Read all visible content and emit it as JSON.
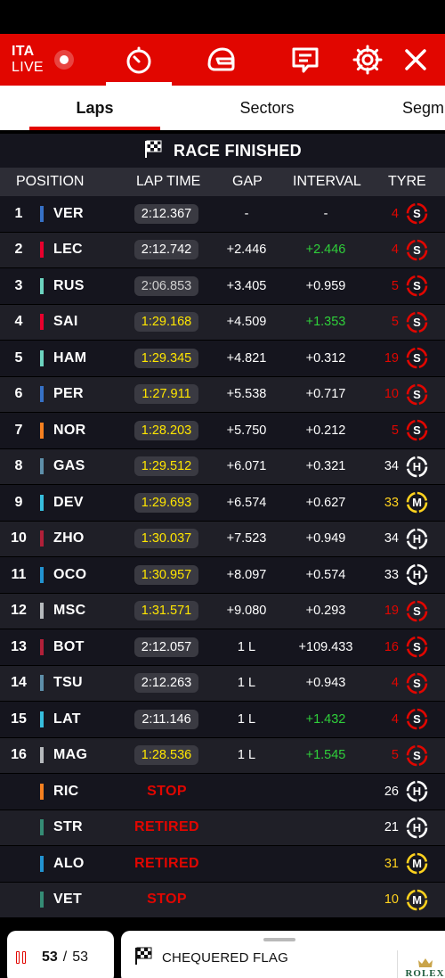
{
  "topbar": {
    "session_code": "ITA",
    "live_label": "LIVE",
    "icons": [
      "timer-icon",
      "helmet-icon",
      "chat-icon",
      "gear-icon",
      "close-icon"
    ],
    "accent": "#e10600"
  },
  "tabs": [
    {
      "label": "Laps",
      "active": true
    },
    {
      "label": "Sectors",
      "active": false
    },
    {
      "label": "Segm",
      "active": false
    }
  ],
  "race_status": {
    "label": "RACE FINISHED",
    "icon": "chequered-flag-icon"
  },
  "columns": {
    "position": "POSITION",
    "lap_time": "LAP TIME",
    "gap": "GAP",
    "interval": "INTERVAL",
    "tyre": "TYRE"
  },
  "colors": {
    "fastest_lap": "#ffe600",
    "interval_gain": "#2fcf3a",
    "soft": "#e10600",
    "medium": "#ffd21e",
    "hard": "#ffffff"
  },
  "drivers": [
    {
      "pos": "1",
      "code": "VER",
      "team_color": "#3671c6",
      "lap_time": "2:12.367",
      "lap_style": "normal",
      "gap": "-",
      "interval": "-",
      "interval_green": false,
      "laps": "4",
      "tyre": "S"
    },
    {
      "pos": "2",
      "code": "LEC",
      "team_color": "#e8002d",
      "lap_time": "2:12.742",
      "lap_style": "normal",
      "gap": "+2.446",
      "interval": "+2.446",
      "interval_green": true,
      "laps": "4",
      "tyre": "S"
    },
    {
      "pos": "3",
      "code": "RUS",
      "team_color": "#6cd3bf",
      "lap_time": "2:06.853",
      "lap_style": "dim",
      "gap": "+3.405",
      "interval": "+0.959",
      "interval_green": false,
      "laps": "5",
      "tyre": "S"
    },
    {
      "pos": "4",
      "code": "SAI",
      "team_color": "#e8002d",
      "lap_time": "1:29.168",
      "lap_style": "fast",
      "gap": "+4.509",
      "interval": "+1.353",
      "interval_green": true,
      "laps": "5",
      "tyre": "S"
    },
    {
      "pos": "5",
      "code": "HAM",
      "team_color": "#6cd3bf",
      "lap_time": "1:29.345",
      "lap_style": "fast",
      "gap": "+4.821",
      "interval": "+0.312",
      "interval_green": false,
      "laps": "19",
      "tyre": "S"
    },
    {
      "pos": "6",
      "code": "PER",
      "team_color": "#3671c6",
      "lap_time": "1:27.911",
      "lap_style": "fast",
      "gap": "+5.538",
      "interval": "+0.717",
      "interval_green": false,
      "laps": "10",
      "tyre": "S"
    },
    {
      "pos": "7",
      "code": "NOR",
      "team_color": "#f58020",
      "lap_time": "1:28.203",
      "lap_style": "fast",
      "gap": "+5.750",
      "interval": "+0.212",
      "interval_green": false,
      "laps": "5",
      "tyre": "S"
    },
    {
      "pos": "8",
      "code": "GAS",
      "team_color": "#5e8faa",
      "lap_time": "1:29.512",
      "lap_style": "fast",
      "gap": "+6.071",
      "interval": "+0.321",
      "interval_green": false,
      "laps": "34",
      "tyre": "H"
    },
    {
      "pos": "9",
      "code": "DEV",
      "team_color": "#37bedd",
      "lap_time": "1:29.693",
      "lap_style": "fast",
      "gap": "+6.574",
      "interval": "+0.627",
      "interval_green": false,
      "laps": "33",
      "tyre": "M"
    },
    {
      "pos": "10",
      "code": "ZHO",
      "team_color": "#b12039",
      "lap_time": "1:30.037",
      "lap_style": "fast",
      "gap": "+7.523",
      "interval": "+0.949",
      "interval_green": false,
      "laps": "34",
      "tyre": "H"
    },
    {
      "pos": "11",
      "code": "OCO",
      "team_color": "#2293d1",
      "lap_time": "1:30.957",
      "lap_style": "fast",
      "gap": "+8.097",
      "interval": "+0.574",
      "interval_green": false,
      "laps": "33",
      "tyre": "H"
    },
    {
      "pos": "12",
      "code": "MSC",
      "team_color": "#b6babd",
      "lap_time": "1:31.571",
      "lap_style": "fast",
      "gap": "+9.080",
      "interval": "+0.293",
      "interval_green": false,
      "laps": "19",
      "tyre": "S"
    },
    {
      "pos": "13",
      "code": "BOT",
      "team_color": "#b12039",
      "lap_time": "2:12.057",
      "lap_style": "normal",
      "gap": "1 L",
      "interval": "+109.433",
      "interval_green": false,
      "laps": "16",
      "tyre": "S"
    },
    {
      "pos": "14",
      "code": "TSU",
      "team_color": "#5e8faa",
      "lap_time": "2:12.263",
      "lap_style": "normal",
      "gap": "1 L",
      "interval": "+0.943",
      "interval_green": false,
      "laps": "4",
      "tyre": "S"
    },
    {
      "pos": "15",
      "code": "LAT",
      "team_color": "#37bedd",
      "lap_time": "2:11.146",
      "lap_style": "normal",
      "gap": "1 L",
      "interval": "+1.432",
      "interval_green": true,
      "laps": "4",
      "tyre": "S"
    },
    {
      "pos": "16",
      "code": "MAG",
      "team_color": "#b6babd",
      "lap_time": "1:28.536",
      "lap_style": "fast",
      "gap": "1 L",
      "interval": "+1.545",
      "interval_green": true,
      "laps": "5",
      "tyre": "S"
    },
    {
      "pos": "",
      "code": "RIC",
      "team_color": "#f58020",
      "status": "STOP",
      "laps": "26",
      "tyre": "H"
    },
    {
      "pos": "",
      "code": "STR",
      "team_color": "#358c75",
      "status": "RETIRED",
      "laps": "21",
      "tyre": "H"
    },
    {
      "pos": "",
      "code": "ALO",
      "team_color": "#2293d1",
      "status": "RETIRED",
      "laps": "31",
      "tyre": "M"
    },
    {
      "pos": "",
      "code": "VET",
      "team_color": "#358c75",
      "status": "STOP",
      "laps": "10",
      "tyre": "M"
    }
  ],
  "footer": {
    "current_lap": "53",
    "separator": "/",
    "total_laps": "53",
    "flag_label": "CHEQUERED FLAG",
    "sponsor": "ROLEX"
  }
}
